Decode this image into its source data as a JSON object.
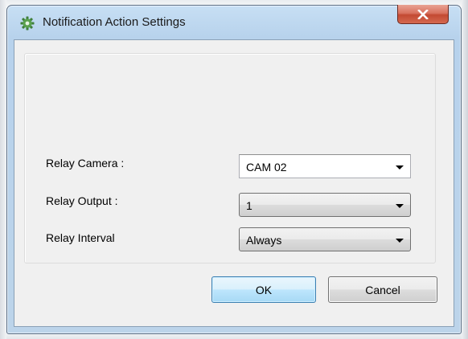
{
  "window": {
    "title": "Notification Action Settings",
    "app_icon": "gear-icon",
    "close_icon": "close-icon"
  },
  "form": {
    "fields": [
      {
        "label": "Relay Camera :",
        "value": "CAM 02"
      },
      {
        "label": "Relay Output :",
        "value": "1"
      },
      {
        "label": "Relay Interval",
        "value": "Always"
      }
    ]
  },
  "buttons": {
    "ok_label": "OK",
    "cancel_label": "Cancel"
  },
  "colors": {
    "titlebar": "#bcd4ea",
    "close_button": "#c34a33",
    "dialog_background": "#f0f0f0",
    "ok_button_border": "#3c7fb1"
  }
}
